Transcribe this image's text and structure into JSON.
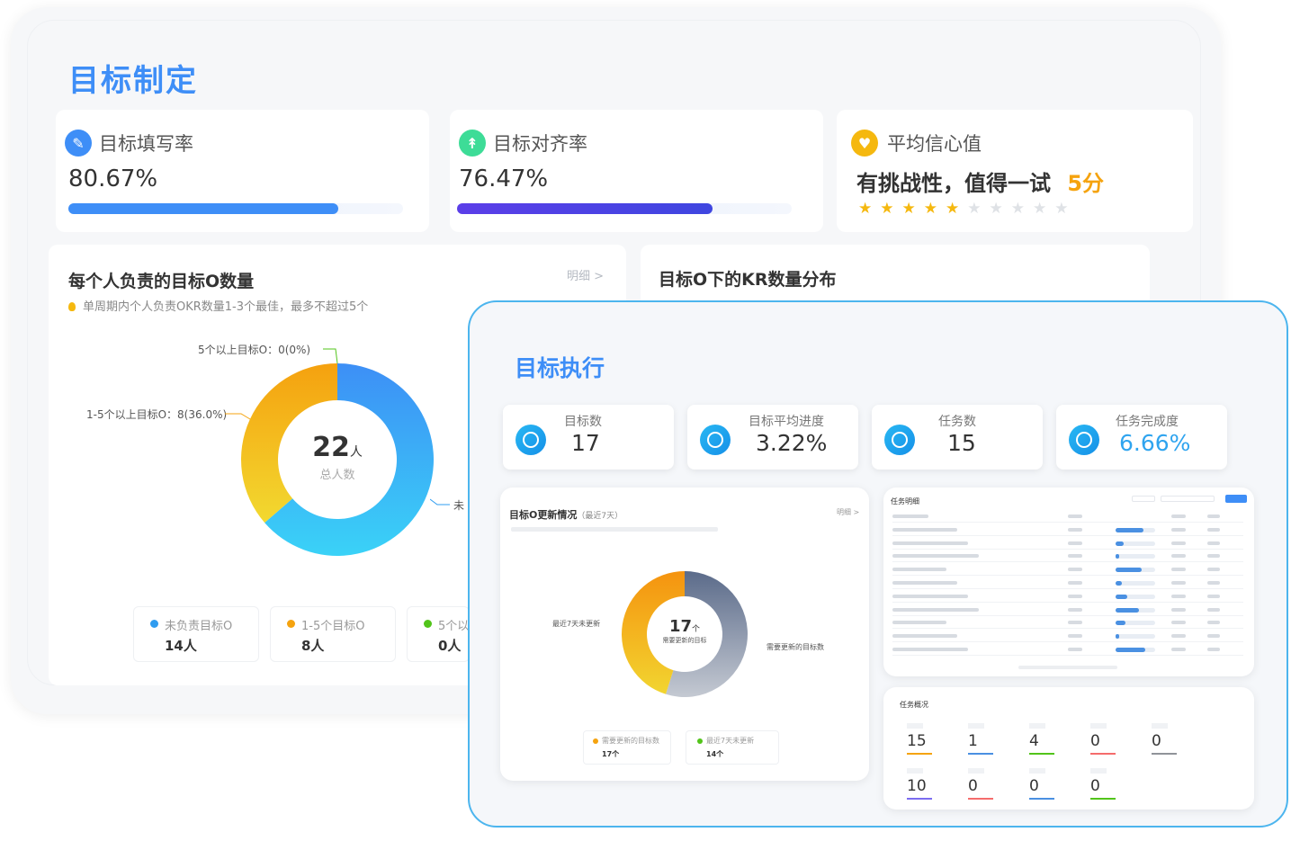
{
  "plan": {
    "title": "目标制定",
    "fill_rate": {
      "label": "目标填写率",
      "value": "80.67%",
      "progress": 0.8067,
      "color": "#3e8ef7"
    },
    "align_rate": {
      "label": "目标对齐率",
      "value": "76.47%",
      "progress": 0.7647,
      "color": "#4b3ce8"
    },
    "confidence": {
      "label": "平均信心值",
      "text": "有挑战性，值得一试",
      "score": "5分",
      "stars_on": 5,
      "stars_total": 10
    },
    "per_person": {
      "title": "每个人负责的目标O数量",
      "hint": "单周期内个人负责OKR数量1-3个最佳，最多不超过5个",
      "detail": "明细 >",
      "center_value": "22",
      "center_unit": "人",
      "center_label": "总人数",
      "label_over5": "5个以上目标O：0(0%)",
      "label_1to5": "1-5个以上目标O：8(36.0%)",
      "label_none": "未",
      "legend": [
        {
          "name": "未负责目标O",
          "value": "14人",
          "color": "#2f9cf0"
        },
        {
          "name": "1-5个目标O",
          "value": "8人",
          "color": "#f5a30f"
        },
        {
          "name": "5个以",
          "value": "0人",
          "color": "#52c41a"
        }
      ]
    },
    "kr_dist": {
      "title": "目标O下的KR数量分布"
    }
  },
  "chart_data": {
    "type": "pie",
    "title": "每个人负责的目标O数量",
    "categories": [
      "未负责目标O",
      "1-5个目标O",
      "5个以上目标O"
    ],
    "values": [
      14,
      8,
      0
    ],
    "total": 22
  },
  "exec": {
    "title": "目标执行",
    "kpis": [
      {
        "label": "目标数",
        "value": "17",
        "icon": "target-icon"
      },
      {
        "label": "目标平均进度",
        "value": "3.22%",
        "icon": "clock-icon"
      },
      {
        "label": "任务数",
        "value": "15",
        "icon": "list-icon"
      },
      {
        "label": "任务完成度",
        "value": "6.66%",
        "icon": "task-icon"
      }
    ],
    "update_card": {
      "title": "目标O更新情况",
      "subtitle": "（最近7天）",
      "detail": "明细 >",
      "center_value": "17",
      "center_unit": "个",
      "center_label": "需要更新的目标",
      "label_left": "最近7天未更新",
      "label_right": "需要更新的目标数",
      "legend": [
        {
          "name": "需要更新的目标数",
          "value": "17个",
          "color": "#f5a30f"
        },
        {
          "name": "最近7天未更新",
          "value": "14个",
          "color": "#52c41a"
        }
      ]
    },
    "task_table": {
      "title": "任务明细"
    },
    "task_overview": {
      "title": "任务概况",
      "items": [
        {
          "value": "15",
          "color": "#f5a30f"
        },
        {
          "value": "1",
          "color": "#4a90e2"
        },
        {
          "value": "4",
          "color": "#52c41a"
        },
        {
          "value": "0",
          "color": "#f56c6c"
        },
        {
          "value": "0",
          "color": "#909399"
        },
        {
          "value": "10",
          "color": "#7c6cf0"
        },
        {
          "value": "0",
          "color": "#f56c6c"
        },
        {
          "value": "0",
          "color": "#4a90e2"
        },
        {
          "value": "0",
          "color": "#52c41a"
        }
      ]
    }
  }
}
